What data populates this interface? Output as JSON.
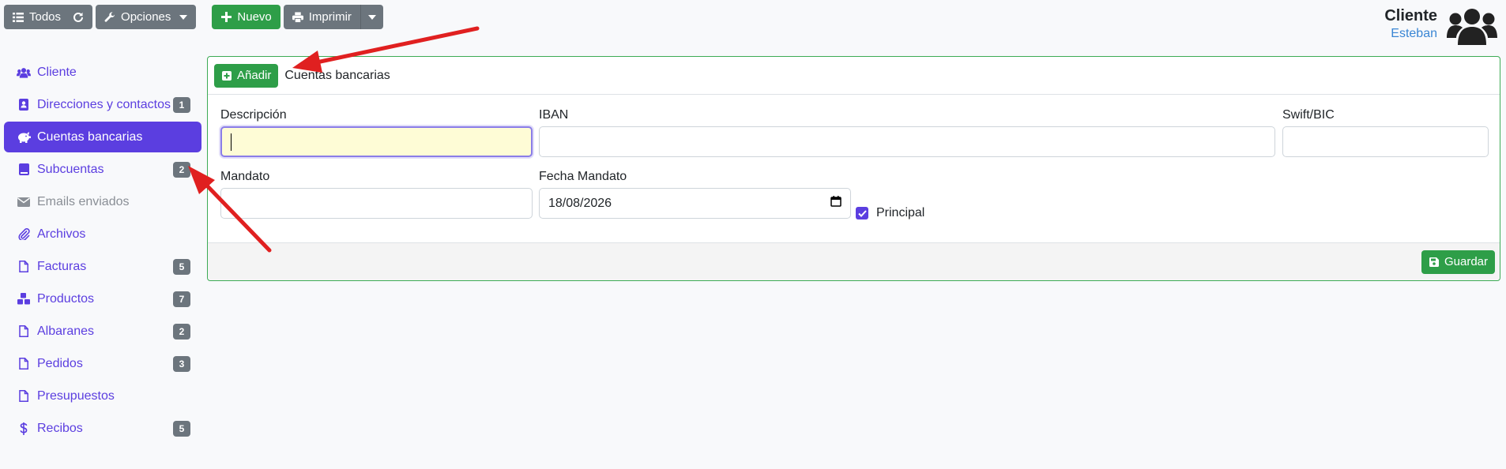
{
  "toolbar": {
    "all_label": "Todos",
    "options_label": "Opciones",
    "new_label": "Nuevo",
    "print_label": "Imprimir"
  },
  "header": {
    "title": "Cliente",
    "subtitle": "Esteban"
  },
  "sidebar": {
    "items": [
      {
        "label": "Cliente",
        "icon": "users-icon",
        "badge": ""
      },
      {
        "label": "Direcciones y contactos",
        "icon": "address-book-icon",
        "badge": "1"
      },
      {
        "label": "Cuentas bancarias",
        "icon": "piggy-bank-icon",
        "badge": ""
      },
      {
        "label": "Subcuentas",
        "icon": "book-icon",
        "badge": "2"
      },
      {
        "label": "Emails enviados",
        "icon": "envelope-icon",
        "badge": ""
      },
      {
        "label": "Archivos",
        "icon": "paperclip-icon",
        "badge": ""
      },
      {
        "label": "Facturas",
        "icon": "file-icon",
        "badge": "5"
      },
      {
        "label": "Productos",
        "icon": "cubes-icon",
        "badge": "7"
      },
      {
        "label": "Albaranes",
        "icon": "file-icon",
        "badge": "2"
      },
      {
        "label": "Pedidos",
        "icon": "file-icon",
        "badge": "3"
      },
      {
        "label": "Presupuestos",
        "icon": "file-icon",
        "badge": ""
      },
      {
        "label": "Recibos",
        "icon": "dollar-icon",
        "badge": "5"
      }
    ]
  },
  "card": {
    "add_label": "Añadir",
    "title": "Cuentas bancarias",
    "fields": {
      "descripcion_label": "Descripción",
      "descripcion_value": "",
      "iban_label": "IBAN",
      "iban_value": "",
      "swift_label": "Swift/BIC",
      "swift_value": "",
      "mandato_label": "Mandato",
      "mandato_value": "",
      "fecha_label": "Fecha Mandato",
      "fecha_value": "18/08/2026",
      "principal_label": "Principal",
      "principal_checked": true
    },
    "save_label": "Guardar"
  },
  "colors": {
    "primary": "#5b3ee0",
    "success": "#2e9e48",
    "secondary": "#6c757d",
    "annotation_arrow": "#e02020"
  }
}
